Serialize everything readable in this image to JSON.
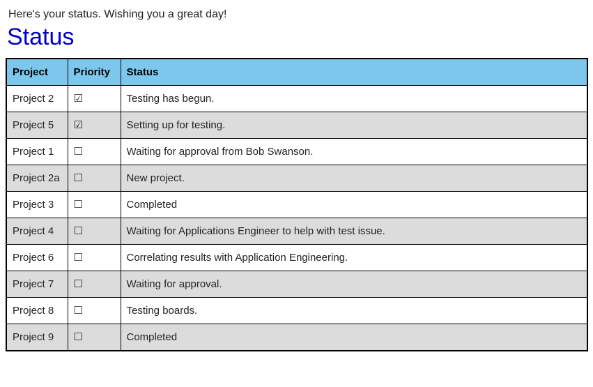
{
  "intro": "Here's your status. Wishing you a great day!",
  "title": "Status",
  "columns": {
    "project": "Project",
    "priority": "Priority",
    "status": "Status"
  },
  "glyphs": {
    "checked": "☑",
    "unchecked": "☐"
  },
  "rows": [
    {
      "project": "Project 2",
      "priority": true,
      "status": "Testing has begun."
    },
    {
      "project": "Project 5",
      "priority": true,
      "status": "Setting up for testing."
    },
    {
      "project": "Project 1",
      "priority": false,
      "status": "Waiting for approval from Bob Swanson."
    },
    {
      "project": "Project 2a",
      "priority": false,
      "status": "New project."
    },
    {
      "project": "Project 3",
      "priority": false,
      "status": "Completed"
    },
    {
      "project": "Project 4",
      "priority": false,
      "status": "Waiting for Applications Engineer to help with test issue."
    },
    {
      "project": "Project 6",
      "priority": false,
      "status": "Correlating results with Application Engineering."
    },
    {
      "project": "Project 7",
      "priority": false,
      "status": "Waiting for approval."
    },
    {
      "project": "Project 8",
      "priority": false,
      "status": "Testing boards."
    },
    {
      "project": "Project 9",
      "priority": false,
      "status": "Completed"
    }
  ]
}
